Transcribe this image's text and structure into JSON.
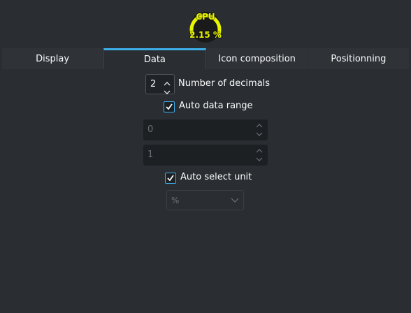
{
  "gauge": {
    "title": "CPU",
    "value_text": "2.15 %",
    "value_fraction": 0.0215,
    "color": "#e8f500",
    "icon": "gauge-icon"
  },
  "tabs": [
    {
      "label": "Display",
      "active": false
    },
    {
      "label": "Data",
      "active": true
    },
    {
      "label": "Icon composition",
      "active": false
    },
    {
      "label": "Positionning",
      "active": false
    }
  ],
  "decimals": {
    "value": "2",
    "label": "Number of decimals"
  },
  "auto_range": {
    "checked": true,
    "label": "Auto data range"
  },
  "range": {
    "min": "0",
    "max": "1"
  },
  "auto_unit": {
    "checked": true,
    "label": "Auto select unit"
  },
  "unit": {
    "selected": "%"
  },
  "colors": {
    "accent": "#3daee9",
    "background": "#2a2e32"
  }
}
